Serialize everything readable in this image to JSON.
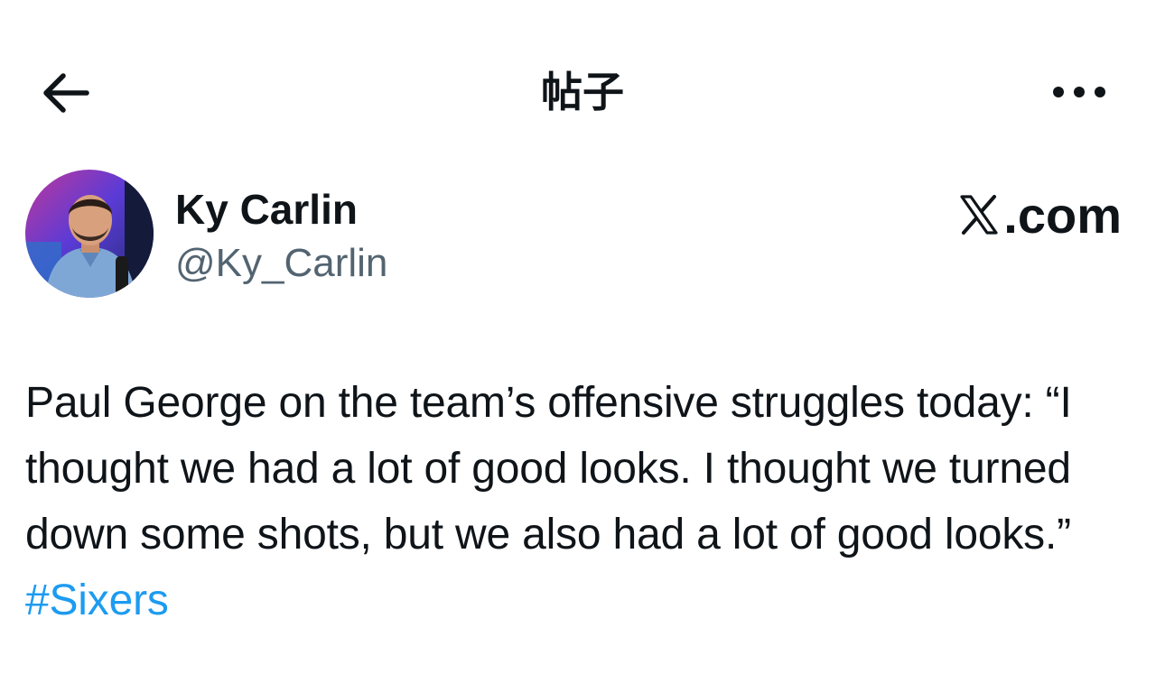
{
  "header": {
    "title": "帖子",
    "back_icon": "arrow-left-icon",
    "more_icon": "more-horizontal-icon"
  },
  "author": {
    "display_name": "Ky Carlin",
    "handle": "@Ky_Carlin",
    "avatar_icon": "avatar"
  },
  "brand": {
    "logo_icon": "x-logo-icon",
    "label": ".com"
  },
  "tweet": {
    "text": "Paul George on the team’s offensive struggles today: “I thought we had a lot of good looks. I thought we turned down some shots, but we also had a lot of good looks.” ",
    "hashtag": "#Sixers"
  },
  "colors": {
    "text_primary": "#0f1419",
    "text_secondary": "#536471",
    "link": "#1d9bf0",
    "background": "#ffffff"
  }
}
